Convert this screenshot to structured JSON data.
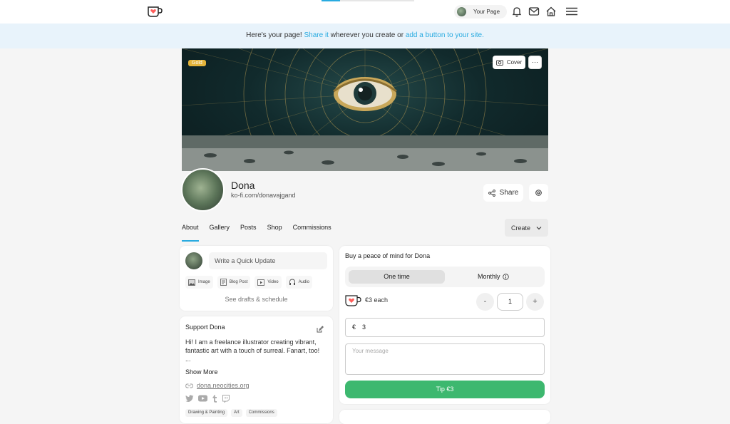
{
  "topnav": {
    "your_page_label": "Your Page",
    "icons": [
      "ko-fi-logo-icon",
      "bell-icon",
      "mail-icon",
      "home-icon",
      "menu-icon"
    ]
  },
  "banner": {
    "prefix": "Here's your page!",
    "share_link": "Share it",
    "middle": "wherever you create or",
    "button_link": "add a button to your site."
  },
  "cover": {
    "badge": "Gold",
    "cover_button": "Cover"
  },
  "profile": {
    "name": "Dona",
    "url": "ko-fi.com/donavajgand",
    "share_label": "Share"
  },
  "tabs": [
    "About",
    "Gallery",
    "Posts",
    "Shop",
    "Commissions"
  ],
  "create_label": "Create",
  "quick_update": {
    "placeholder": "Write a Quick Update",
    "actions": [
      "Image",
      "Blog Post",
      "Video",
      "Audio"
    ],
    "drafts": "See drafts & schedule"
  },
  "support": {
    "title": "Support Dona",
    "bio": "Hi! I am a freelance illustrator creating vibrant, fantastic art with a touch of surreal. Fanart, too!",
    "ellipsis": "...",
    "show_more": "Show More",
    "link": "dona.neocities.org",
    "tags": [
      "Drawing & Painting",
      "Art",
      "Commissions"
    ]
  },
  "tip": {
    "title": "Buy a peace of mind for Dona",
    "one_time": "One time",
    "monthly": "Monthly",
    "each": "€3 each",
    "minus": "-",
    "plus": "+",
    "quantity": "1",
    "currency": "€",
    "amount": "3",
    "message_placeholder": "Your message",
    "button": "Tip €3"
  },
  "colors": {
    "accent": "#29abe0",
    "tip_green": "#3db86f",
    "gold": "#e4b43a"
  }
}
